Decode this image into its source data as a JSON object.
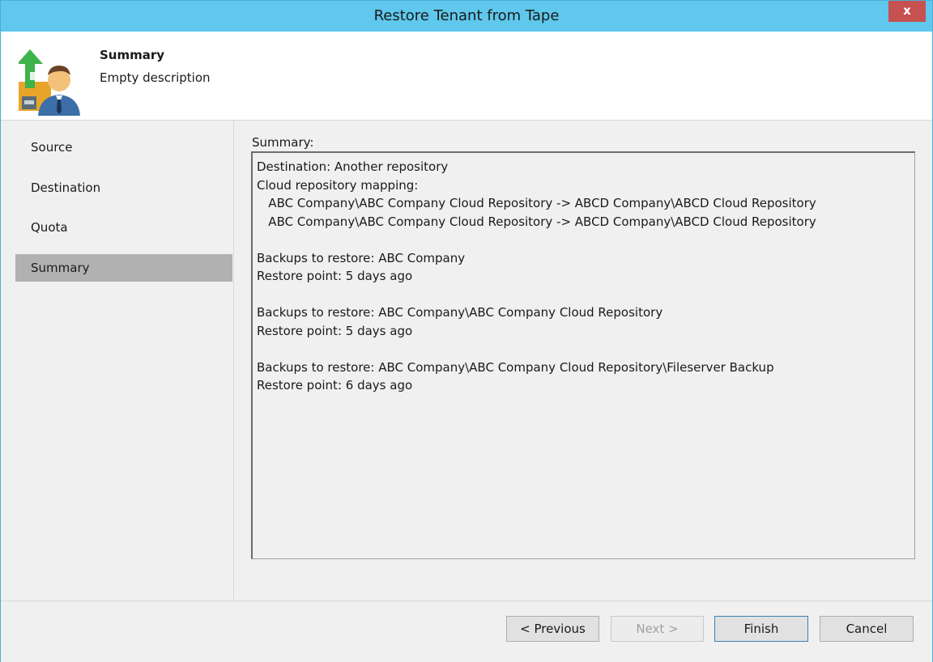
{
  "window": {
    "title": "Restore Tenant from Tape",
    "close_label": "x"
  },
  "header": {
    "title": "Summary",
    "description": "Empty description"
  },
  "sidebar": {
    "items": [
      {
        "label": "Source",
        "active": false
      },
      {
        "label": "Destination",
        "active": false
      },
      {
        "label": "Quota",
        "active": false
      },
      {
        "label": "Summary",
        "active": true
      }
    ]
  },
  "main": {
    "summary_label": "Summary:",
    "summary_lines": [
      "Destination: Another repository",
      "Cloud repository mapping:",
      "   ABC Company\\ABC Company Cloud Repository -> ABCD Company\\ABCD Cloud Repository",
      "   ABC Company\\ABC Company Cloud Repository -> ABCD Company\\ABCD Cloud Repository",
      "",
      "Backups to restore: ABC Company",
      "Restore point: 5 days ago",
      "",
      "Backups to restore: ABC Company\\ABC Company Cloud Repository",
      "Restore point: 5 days ago",
      "",
      "Backups to restore: ABC Company\\ABC Company Cloud Repository\\Fileserver Backup",
      "Restore point: 6 days ago"
    ]
  },
  "footer": {
    "previous_label": "< Previous",
    "next_label": "Next >",
    "finish_label": "Finish",
    "cancel_label": "Cancel"
  },
  "colors": {
    "titlebar": "#5fc8ec",
    "close_button": "#c75050",
    "active_nav": "#b1b1b1"
  },
  "icons": {
    "wizard": "restore-tenant-icon"
  }
}
